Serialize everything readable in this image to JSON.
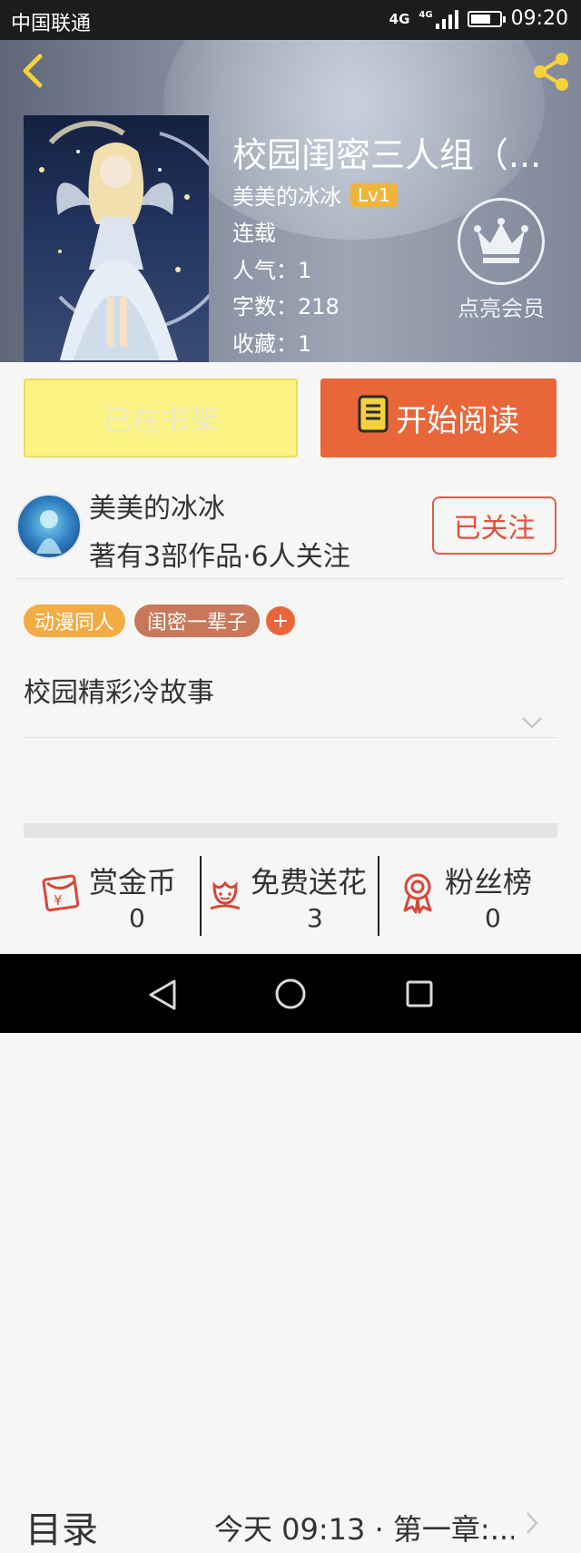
{
  "status_bar": {
    "carrier": "中国联通",
    "network": "4G",
    "network2": "4G",
    "time": "09:20",
    "battery_level": 0.7
  },
  "header": {
    "back_icon": "back-chevron-icon",
    "share_icon": "share-icon"
  },
  "book": {
    "title": "校园闺密三人组（...",
    "author": "美美的冰冰",
    "author_level": "Lv1",
    "status": "连载",
    "popularity": "人气：1",
    "word_count": "字数：218",
    "favorites": "收藏：1",
    "vip_label": "点亮会员",
    "vip_icon": "crown-icon"
  },
  "actions": {
    "shelf_label": "已在书架",
    "read_label": "开始阅读",
    "read_icon": "book-icon"
  },
  "author_card": {
    "name": "美美的冰冰",
    "stats": "著有3部作品·6人关注",
    "follow_label": "已关注"
  },
  "tags": {
    "items": [
      "动漫同人",
      "闺密一辈子"
    ],
    "add_label": "+"
  },
  "description": {
    "text": "校园精彩冷故事"
  },
  "toc": {
    "label": "目录",
    "latest": "今天 09:13 · 第一章:..."
  },
  "stats": [
    {
      "name": "赏金币",
      "value": "0",
      "icon": "red-envelope-icon"
    },
    {
      "name": "免费送花",
      "value": "3",
      "icon": "flower-icon"
    },
    {
      "name": "粉丝榜",
      "value": "0",
      "icon": "medal-icon"
    }
  ],
  "colors": {
    "accent_orange": "#e8663a",
    "shelf_yellow": "#fbf484",
    "follow_red": "#e0503e",
    "tag_orange": "#f3ab45",
    "tag_brown": "#c9775a",
    "icon_yellow": "#f5d13c"
  }
}
